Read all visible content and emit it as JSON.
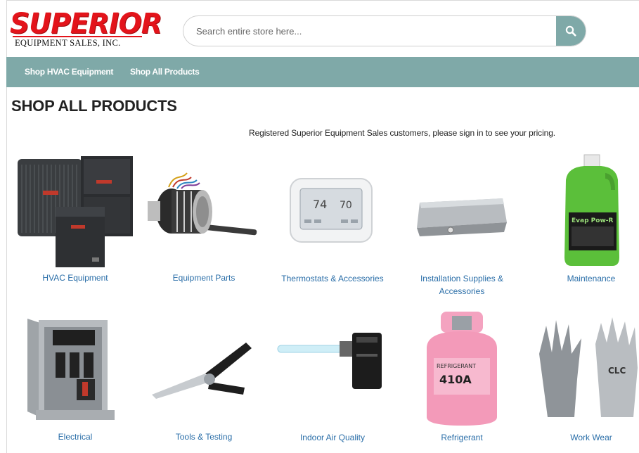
{
  "brand": {
    "logo_main": "SUPERIOR",
    "logo_sub": "EQUIPMENT SALES, INC."
  },
  "search": {
    "placeholder": "Search entire store here...",
    "value": "",
    "button_icon": "search-icon"
  },
  "nav": {
    "items": [
      {
        "label": "Shop HVAC Equipment"
      },
      {
        "label": "Shop All Products"
      }
    ]
  },
  "page": {
    "title": "SHOP ALL PRODUCTS",
    "notice": "Registered Superior Equipment Sales customers, please sign in to see your pricing."
  },
  "categories": [
    {
      "label": "HVAC Equipment",
      "image": "hvac-units-image"
    },
    {
      "label": "Equipment Parts",
      "image": "motor-image"
    },
    {
      "label": "Thermostats & Accessories",
      "image": "thermostat-image"
    },
    {
      "label": "Installation Supplies & Accessories",
      "image": "drain-pan-image"
    },
    {
      "label": "Maintenance",
      "image": "cleaner-jug-image"
    },
    {
      "label": "Electrical",
      "image": "disconnect-box-image"
    },
    {
      "label": "Tools & Testing",
      "image": "snips-tool-image"
    },
    {
      "label": "Indoor Air Quality",
      "image": "uv-light-image"
    },
    {
      "label": "Refrigerant",
      "image": "refrigerant-tank-image"
    },
    {
      "label": "Work Wear",
      "image": "gloves-image"
    }
  ],
  "product_text": {
    "thermostat_temp_1": "74",
    "thermostat_temp_2": "70",
    "jug_label": "Evap Pow-R",
    "tank_label": "REFRIGERANT",
    "tank_type": "410A",
    "glove_brand": "CLC"
  },
  "colors": {
    "accent": "#7fa9a8",
    "brand_red": "#e3141b",
    "link": "#2a6ea8"
  }
}
